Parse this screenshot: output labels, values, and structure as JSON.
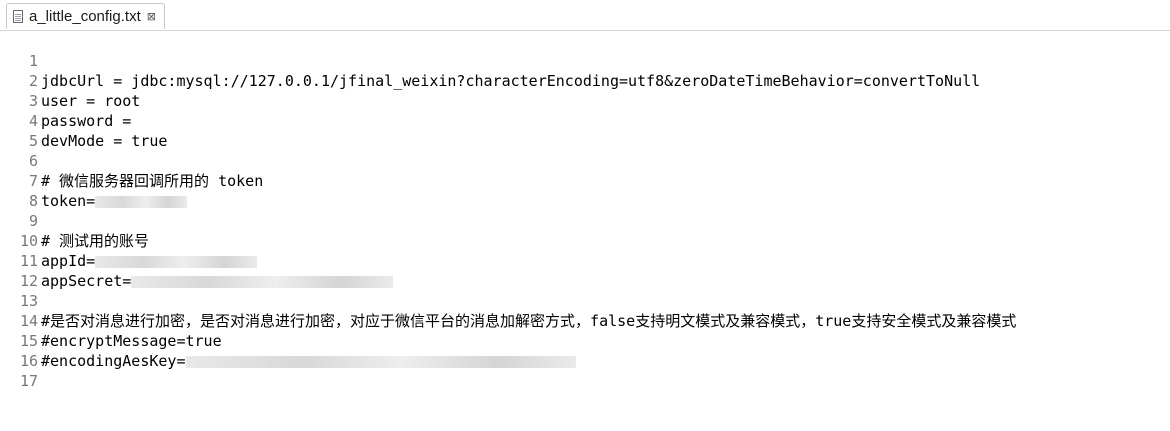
{
  "tab": {
    "title": "a_little_config.txt",
    "close_glyph": "⊠",
    "file_icon": "text-file-icon"
  },
  "editor": {
    "lines": [
      {
        "n": "1",
        "text": "jdbcUrl = jdbc:mysql://127.0.0.1/jfinal_weixin?characterEncoding=utf8&zeroDateTimeBehavior=convertToNull"
      },
      {
        "n": "2",
        "text": "user = root"
      },
      {
        "n": "3",
        "text": "password ="
      },
      {
        "n": "4",
        "text": "devMode = true"
      },
      {
        "n": "5",
        "text": ""
      },
      {
        "n": "6",
        "text": "# 微信服务器回调所用的 token"
      },
      {
        "n": "7",
        "text": "token="
      },
      {
        "n": "8",
        "text": ""
      },
      {
        "n": "9",
        "text": "# 测试用的账号"
      },
      {
        "n": "10",
        "text": "appId="
      },
      {
        "n": "11",
        "text": "appSecret="
      },
      {
        "n": "12",
        "text": ""
      },
      {
        "n": "13",
        "text": "#是否对消息进行加密，是否对消息进行加密，对应于微信平台的消息加解密方式，false支持明文模式及兼容模式，true支持安全模式及兼容模式"
      },
      {
        "n": "14",
        "text": "#encryptMessage=true"
      },
      {
        "n": "15",
        "text": "#encodingAesKey="
      },
      {
        "n": "16",
        "text": ""
      },
      {
        "n": "17",
        "text": ""
      }
    ]
  }
}
